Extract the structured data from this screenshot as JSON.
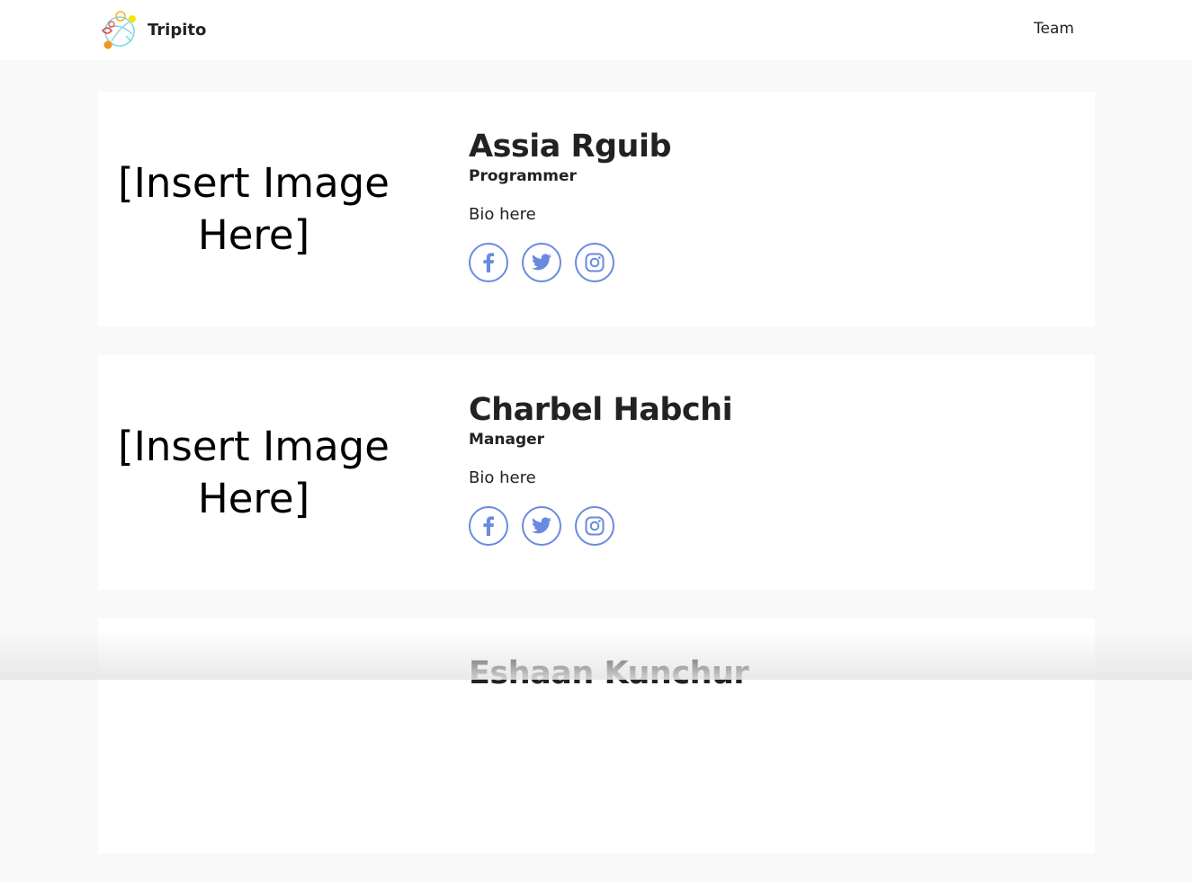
{
  "brand": {
    "name": "Tripito"
  },
  "nav": {
    "links": [
      {
        "label": "Team"
      }
    ]
  },
  "team": {
    "members": [
      {
        "image_placeholder": "[Insert Image Here]",
        "name": "Assia Rguib",
        "role": "Programmer",
        "bio": "Bio here",
        "socials": [
          "facebook-icon",
          "twitter-icon",
          "instagram-icon"
        ]
      },
      {
        "image_placeholder": "[Insert Image Here]",
        "name": "Charbel Habchi",
        "role": "Manager",
        "bio": "Bio here",
        "socials": [
          "facebook-icon",
          "twitter-icon",
          "instagram-icon"
        ]
      },
      {
        "image_placeholder": "",
        "name": "Eshaan Kunchur",
        "role": "",
        "bio": "",
        "socials": []
      }
    ]
  },
  "colors": {
    "accent": "#6a8ae0",
    "page_background": "#f9f9f9",
    "card_background": "#ffffff",
    "text": "#222222"
  }
}
